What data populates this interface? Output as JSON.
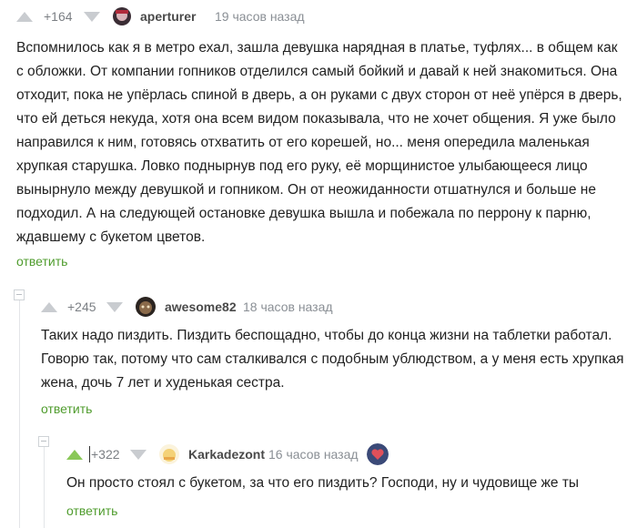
{
  "comments": [
    {
      "rating": "+164",
      "username": "aperturer",
      "time": "19 часов назад",
      "text": "Вспомнилось как я в метро ехал, зашла девушка нарядная в платье, туфлях... в общем как с обложки. От компании гопников отделился самый бойкий и давай к ней знакомиться. Она отходит, пока не упёрлась спиной в дверь, а он руками с двух сторон от неё упёрся в дверь, что ей деться некуда, хотя она всем видом показывала, что не хочет общения. Я уже было направился к ним, готовясь отхватить от его корешей, но... меня опередила маленькая хрупкая старушка. Ловко поднырнув под его руку, её морщинистое улыбающееся лицо вынырнуло между девушкой и гопником. Он от неожиданности отшатнулся и больше не подходил. А на следующей остановке девушка вышла и побежала по перрону к парню, ждавшему с букетом цветов.",
      "reply": "ответить"
    },
    {
      "rating": "+245",
      "username": "awesome82",
      "time": "18 часов назад",
      "text": "Таких надо пиздить. Пиздить беспощадно, чтобы до конца жизни на таблетки работал. Говорю так, потому что сам сталкивался с подобным ублюдством, а у меня есть хрупкая жена, дочь 7 лет и худенькая сестра.",
      "reply": "ответить"
    },
    {
      "rating": "+322",
      "username": "Karkadezont",
      "time": "16 часов назад",
      "text": "Он просто стоял с букетом, за что его пиздить? Господи, ну и чудовище же ты",
      "reply": "ответить"
    }
  ],
  "colors": {
    "accent_green": "#4f9c2d",
    "upvote_active": "#8ac858"
  }
}
